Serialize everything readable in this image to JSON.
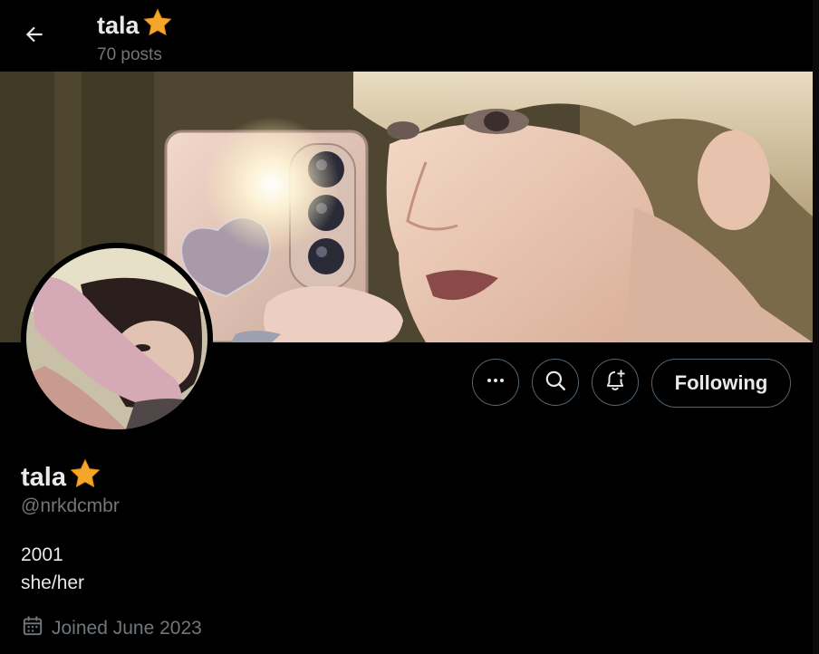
{
  "header": {
    "display_name": "tala",
    "badge_emoji": "star",
    "posts_count": "70 posts"
  },
  "banner": {
    "description": "profile header photo"
  },
  "avatar": {
    "description": "profile photo"
  },
  "actions": {
    "more_icon": "more-horizontal-icon",
    "search_icon": "search-icon",
    "notify_icon": "bell-plus-icon",
    "following_label": "Following"
  },
  "profile": {
    "display_name": "tala",
    "handle": "@nrkdcmbr",
    "bio_lines": [
      "2001",
      "she/her"
    ],
    "joined": "Joined June 2023"
  },
  "colors": {
    "background": "#000000",
    "text_primary": "#e7e9ea",
    "text_secondary": "#71767b",
    "button_border": "#536471",
    "star": "#f4a62a"
  }
}
